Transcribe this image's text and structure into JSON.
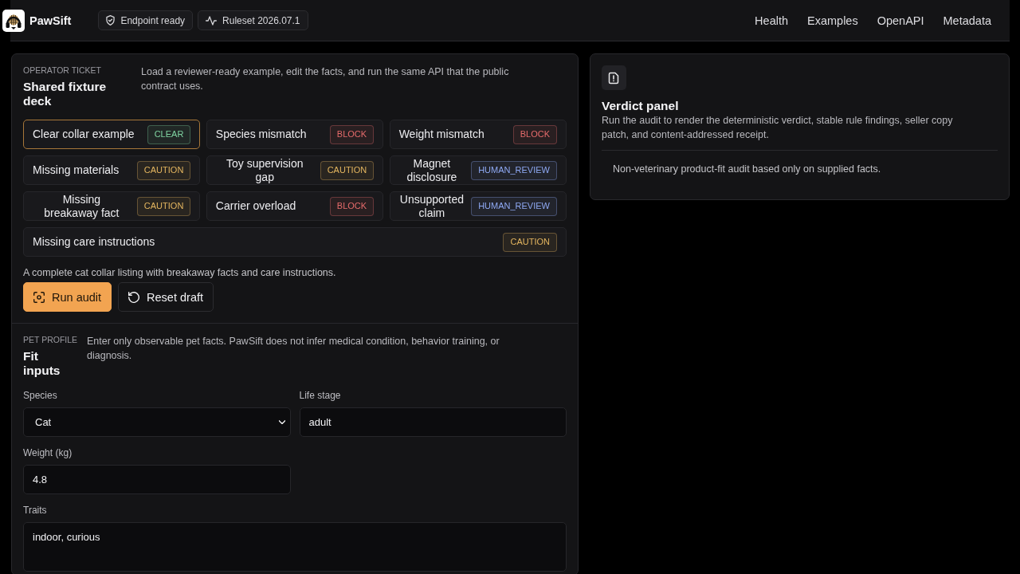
{
  "header": {
    "brand": "PawSift",
    "chips": [
      {
        "kind": "shield",
        "label": "Endpoint ready"
      },
      {
        "kind": "pulse",
        "label": "Ruleset 2026.07.1"
      }
    ],
    "nav": [
      "Health",
      "Examples",
      "OpenAPI",
      "Metadata"
    ]
  },
  "operator_ticket": {
    "eyebrow": "OPERATOR TICKET",
    "title": "Shared fixture deck",
    "description": "Load a reviewer-ready example, edit the facts, and run the same API that the public contract uses.",
    "fixtures": [
      {
        "label": "Clear collar example",
        "badge": "CLEAR",
        "color": "#7fd3a0",
        "selected": true
      },
      {
        "label": "Species mismatch",
        "badge": "BLOCK",
        "color": "#e56b6b",
        "selected": false
      },
      {
        "label": "Weight mismatch",
        "badge": "BLOCK",
        "color": "#e56b6b",
        "selected": false
      },
      {
        "label": "Missing materials",
        "badge": "CAUTION",
        "color": "#e3b55f",
        "selected": false
      },
      {
        "label": "Toy supervision gap",
        "badge": "CAUTION",
        "color": "#e3b55f",
        "selected": false
      },
      {
        "label": "Magnet disclosure",
        "badge": "HUMAN_REVIEW",
        "color": "#8ea8f2",
        "selected": false
      },
      {
        "label": "Missing breakaway fact",
        "badge": "CAUTION",
        "color": "#e3b55f",
        "selected": false
      },
      {
        "label": "Carrier overload",
        "badge": "BLOCK",
        "color": "#e56b6b",
        "selected": false
      },
      {
        "label": "Unsupported claim",
        "badge": "HUMAN_REVIEW",
        "color": "#8ea8f2",
        "selected": false
      },
      {
        "label": "Missing care instructions",
        "badge": "CAUTION",
        "color": "#e3b55f",
        "selected": false
      }
    ],
    "selected_summary": "A complete cat collar listing with breakaway facts and care instructions.",
    "buttons": [
      {
        "kind": "primary",
        "label": "Run audit"
      },
      {
        "kind": "secondary",
        "label": "Reset draft"
      }
    ]
  },
  "pet_profile": {
    "eyebrow": "PET PROFILE",
    "title": "Fit inputs",
    "description": "Enter only observable pet facts. PawSift does not infer medical condition, behavior training, or diagnosis.",
    "fields": [
      {
        "kind": "select",
        "label": "Species",
        "value": "Cat"
      },
      {
        "kind": "text",
        "label": "Life stage",
        "value": "adult"
      },
      {
        "kind": "text",
        "label": "Weight (kg)",
        "value": "4.8"
      },
      {
        "kind": "textarea",
        "label": "Traits",
        "value": "indoor, curious"
      }
    ]
  },
  "verdict_panel": {
    "title": "Verdict panel",
    "description": "Run the audit to render the deterministic verdict, stable rule findings, seller copy patch, and content-addressed receipt.",
    "note": "Non-veterinary product-fit audit based only on supplied facts."
  }
}
